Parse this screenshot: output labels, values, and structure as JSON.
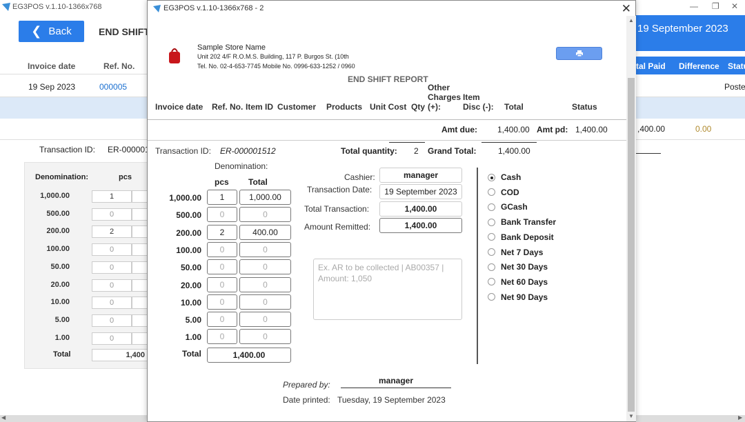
{
  "background": {
    "window_title": "EG3POS v.1.10-1366x768",
    "back_label": "Back",
    "page_title": "END SHIFT",
    "date": "19 September 2023",
    "columns": [
      "Invoice date",
      "Ref. No."
    ],
    "columns_right": [
      "tal Paid",
      "Difference",
      "Statu"
    ],
    "row": {
      "date": "19 Sep 2023",
      "ref": "000005",
      "status": "Poste"
    },
    "total_row": {
      "paid": ",400.00",
      "difference": "0.00"
    },
    "transaction_label": "Transaction ID:",
    "transaction_value": "ER-000001",
    "denom_header": "Denomination:",
    "pcs_header": "pcs",
    "denominations": [
      {
        "label": "1,000.00",
        "pcs": "1"
      },
      {
        "label": "500.00",
        "pcs": "0"
      },
      {
        "label": "200.00",
        "pcs": "2"
      },
      {
        "label": "100.00",
        "pcs": "0"
      },
      {
        "label": "50.00",
        "pcs": "0"
      },
      {
        "label": "20.00",
        "pcs": "0"
      },
      {
        "label": "10.00",
        "pcs": "0"
      },
      {
        "label": "5.00",
        "pcs": "0"
      },
      {
        "label": "1.00",
        "pcs": "0"
      }
    ],
    "total_label": "Total",
    "total_value": "1,400"
  },
  "dialog": {
    "title": "EG3POS v.1.10-1366x768 - 2",
    "store": {
      "name": "Sample Store Name",
      "address": "Unit 202 4/F R.O.M.S. Building, 117 P. Burgos St. (10th",
      "contact": "Tel. No. 02-4-653-7745  Mobile No. 0996-633-1252 / 0960"
    },
    "report_title": "END SHIFT REPORT",
    "columns": {
      "invoice_date": "Invoice date",
      "ref_no": "Ref. No.",
      "item_id": "Item ID",
      "customer": "Customer",
      "products": "Products",
      "unit_cost": "Unit Cost",
      "qty": "Qty",
      "other_charges": "Other Charges (+):",
      "item_disc": "Item Disc (-):",
      "total": "Total",
      "status": "Status"
    },
    "amt_due_label": "Amt due:",
    "amt_due_value": "1,400.00",
    "amt_pd_label": "Amt pd:",
    "amt_pd_value": "1,400.00",
    "transaction_label": "Transaction ID:",
    "transaction_value": "ER-000001512",
    "total_qty_label": "Total quantity:",
    "total_qty_value": "2",
    "grand_total_label": "Grand Total:",
    "grand_total_value": "1,400.00",
    "denom_header": "Denomination:",
    "pcs_header": "pcs",
    "total_header": "Total",
    "denominations": [
      {
        "label": "1,000.00",
        "pcs": "1",
        "total": "1,000.00"
      },
      {
        "label": "500.00",
        "pcs": "0",
        "total": "0"
      },
      {
        "label": "200.00",
        "pcs": "2",
        "total": "400.00"
      },
      {
        "label": "100.00",
        "pcs": "0",
        "total": "0"
      },
      {
        "label": "50.00",
        "pcs": "0",
        "total": "0"
      },
      {
        "label": "20.00",
        "pcs": "0",
        "total": "0"
      },
      {
        "label": "10.00",
        "pcs": "0",
        "total": "0"
      },
      {
        "label": "5.00",
        "pcs": "0",
        "total": "0"
      },
      {
        "label": "1.00",
        "pcs": "0",
        "total": "0"
      }
    ],
    "denom_total_label": "Total",
    "denom_total_value": "1,400.00",
    "cashier_label": "Cashier:",
    "cashier_value": "manager",
    "transaction_date_label": "Transaction Date:",
    "transaction_date_value": "19 September 2023",
    "total_transaction_label": "Total Transaction:",
    "total_transaction_value": "1,400.00",
    "amount_remitted_label": "Amount Remitted:",
    "amount_remitted_value": "1,400.00",
    "notes_placeholder": "Ex. AR to be collected | AB00357 | Amount: 1,050",
    "payment_methods": [
      {
        "label": "Cash",
        "selected": true
      },
      {
        "label": "COD",
        "selected": false
      },
      {
        "label": "GCash",
        "selected": false
      },
      {
        "label": "Bank Transfer",
        "selected": false
      },
      {
        "label": "Bank Deposit",
        "selected": false
      },
      {
        "label": "Net 7 Days",
        "selected": false
      },
      {
        "label": "Net 30 Days",
        "selected": false
      },
      {
        "label": "Net 60 Days",
        "selected": false
      },
      {
        "label": "Net 90 Days",
        "selected": false
      }
    ],
    "prepared_by_label": "Prepared by:",
    "prepared_by_value": "manager",
    "date_printed_label": "Date printed:",
    "date_printed_value": "Tuesday, 19 September 2023"
  },
  "colors": {
    "accent": "#2b7de9",
    "selected_row": "#dce9f8",
    "print_button": "#6b9ef0"
  }
}
